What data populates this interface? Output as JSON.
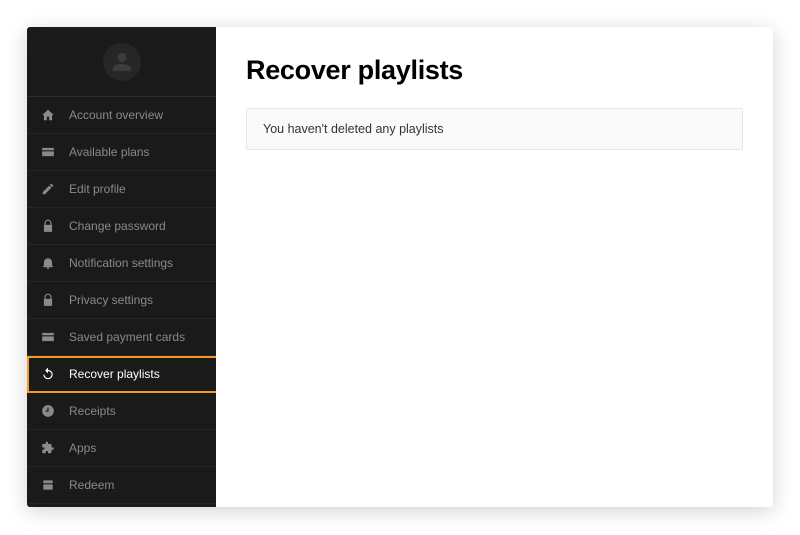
{
  "sidebar": {
    "items": [
      {
        "label": "Account overview",
        "icon": "home-icon"
      },
      {
        "label": "Available plans",
        "icon": "card-icon"
      },
      {
        "label": "Edit profile",
        "icon": "pencil-icon"
      },
      {
        "label": "Change password",
        "icon": "lock-icon"
      },
      {
        "label": "Notification settings",
        "icon": "bell-icon"
      },
      {
        "label": "Privacy settings",
        "icon": "lock-icon"
      },
      {
        "label": "Saved payment cards",
        "icon": "card-icon"
      },
      {
        "label": "Recover playlists",
        "icon": "refresh-icon",
        "active": true
      },
      {
        "label": "Receipts",
        "icon": "clock-icon"
      },
      {
        "label": "Apps",
        "icon": "puzzle-icon"
      },
      {
        "label": "Redeem",
        "icon": "redeem-icon"
      }
    ]
  },
  "main": {
    "title": "Recover playlists",
    "message": "You haven't deleted any playlists"
  },
  "colors": {
    "highlight": "#f59b23",
    "sidebar_bg": "#1a1a1a"
  }
}
